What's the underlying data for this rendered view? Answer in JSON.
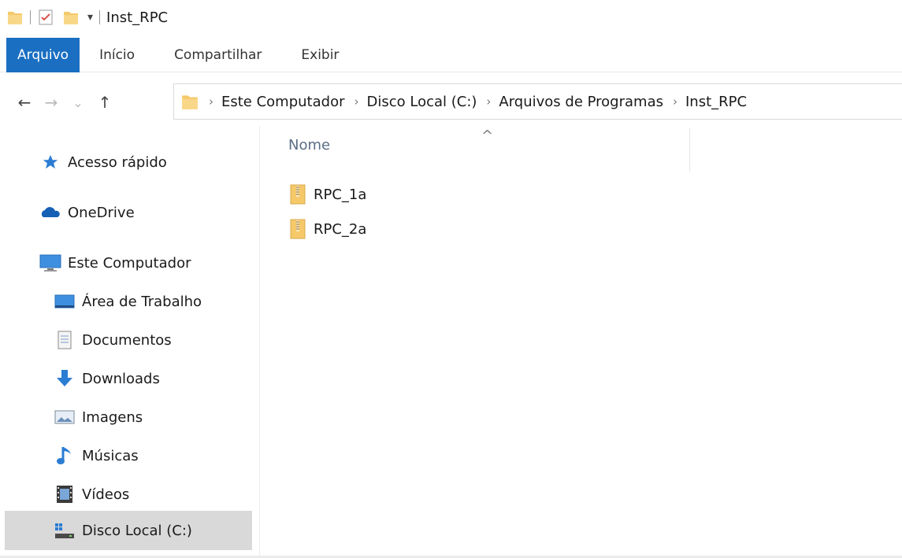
{
  "window": {
    "title": "Inst_RPC",
    "qat_dropdown": "▾"
  },
  "ribbon": {
    "tabs": [
      {
        "label": "Arquivo"
      },
      {
        "label": "Início"
      },
      {
        "label": "Compartilhar"
      },
      {
        "label": "Exibir"
      }
    ]
  },
  "nav": {
    "back": "←",
    "forward": "→",
    "recent": "⌄",
    "up": "↑"
  },
  "address": {
    "separator": "›",
    "breadcrumbs": [
      "Este Computador",
      "Disco Local (C:)",
      "Arquivos de Programas",
      "Inst_RPC"
    ]
  },
  "sidebar": {
    "items": [
      {
        "label": "Acesso rápido",
        "icon": "star-icon"
      },
      {
        "label": "OneDrive",
        "icon": "cloud-icon"
      },
      {
        "label": "Este Computador",
        "icon": "computer-icon"
      },
      {
        "label": "Área de Trabalho",
        "icon": "desktop-icon"
      },
      {
        "label": "Documentos",
        "icon": "document-icon"
      },
      {
        "label": "Downloads",
        "icon": "download-icon"
      },
      {
        "label": "Imagens",
        "icon": "pictures-icon"
      },
      {
        "label": "Músicas",
        "icon": "music-icon"
      },
      {
        "label": "Vídeos",
        "icon": "videos-icon"
      },
      {
        "label": "Disco Local (C:)",
        "icon": "drive-icon",
        "selected": true
      }
    ]
  },
  "content": {
    "column_header": "Nome",
    "sort_indicator": "^",
    "files": [
      {
        "name": "RPC_1a",
        "icon": "zip-folder-icon"
      },
      {
        "name": "RPC_2a",
        "icon": "zip-folder-icon"
      }
    ]
  },
  "colors": {
    "accent": "#1a6fc2",
    "selection": "#d9d9d9",
    "folder": "#f5c96a"
  }
}
